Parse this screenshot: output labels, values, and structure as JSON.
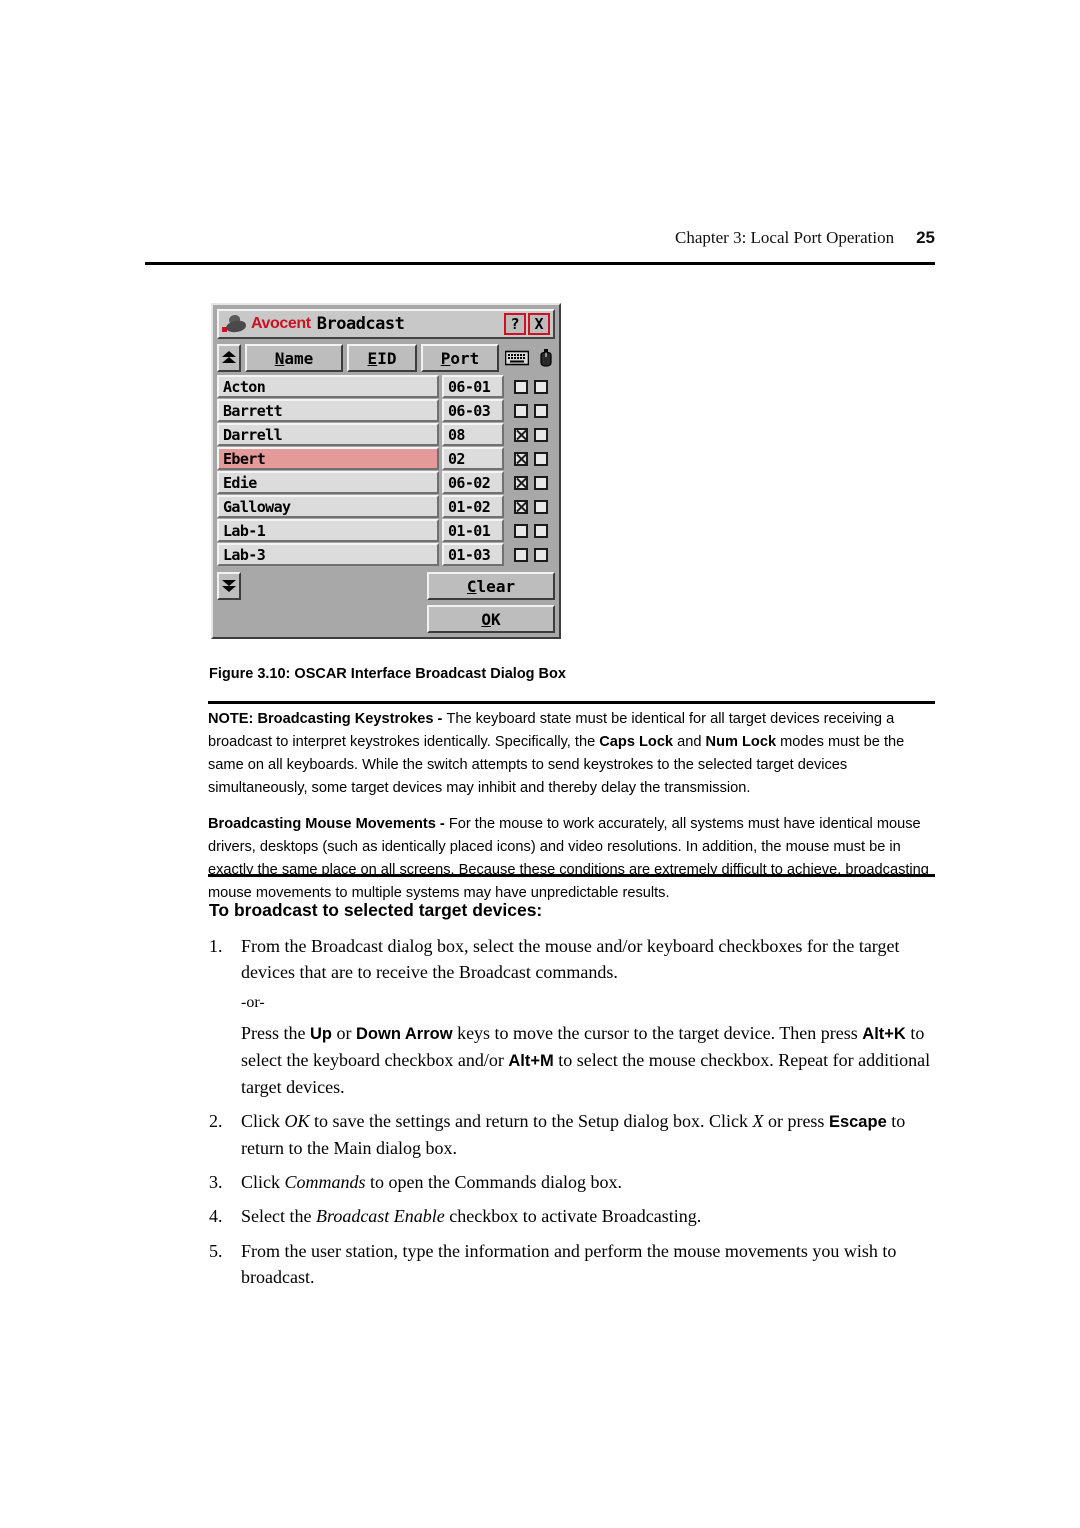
{
  "header": {
    "chapter_title": "Chapter 3: Local Port Operation",
    "page_number": "25"
  },
  "dialog": {
    "logo_word": "Avocent",
    "title": "Broadcast",
    "help_button": "?",
    "close_button": "X",
    "columns": {
      "name": "Name",
      "name_mnemonic": "N",
      "name_rest": "ame",
      "eid": "EID",
      "eid_mnemonic": "E",
      "eid_rest": "ID",
      "port": "Port",
      "port_mnemonic": "P",
      "port_rest": "ort",
      "keyboard_icon": "keyboard-icon",
      "mouse_icon": "mouse-icon"
    },
    "rows": [
      {
        "name": "Acton",
        "port": "06-01",
        "keyboard": false,
        "mouse": false,
        "selected": false
      },
      {
        "name": "Barrett",
        "port": "06-03",
        "keyboard": false,
        "mouse": false,
        "selected": false
      },
      {
        "name": "Darrell",
        "port": "08",
        "keyboard": true,
        "mouse": false,
        "selected": false
      },
      {
        "name": "Ebert",
        "port": "02",
        "keyboard": true,
        "mouse": false,
        "selected": true
      },
      {
        "name": "Edie",
        "port": "06-02",
        "keyboard": true,
        "mouse": false,
        "selected": false
      },
      {
        "name": "Galloway",
        "port": "01-02",
        "keyboard": true,
        "mouse": false,
        "selected": false
      },
      {
        "name": "Lab-1",
        "port": "01-01",
        "keyboard": false,
        "mouse": false,
        "selected": false
      },
      {
        "name": "Lab-3",
        "port": "01-03",
        "keyboard": false,
        "mouse": false,
        "selected": false
      }
    ],
    "buttons": {
      "clear_mnemonic": "C",
      "clear_rest": "lear",
      "ok_mnemonic": "O",
      "ok_rest": "K"
    },
    "scroll_up_icon": "scroll-up-icon",
    "scroll_down_icon": "scroll-down-icon",
    "selected_row_color": "#e59a9a",
    "logo_color": "#cc1122"
  },
  "figure": {
    "caption": "Figure 3.10: OSCAR Interface Broadcast Dialog Box"
  },
  "note": {
    "para1_label": "NOTE: Broadcasting Keystrokes - ",
    "para1_text_a": "The keyboard state must be identical for all target devices receiving a broadcast to interpret keystrokes identically. Specifically, the ",
    "para1_bold_a": "Caps Lock",
    "para1_text_b": " and ",
    "para1_bold_b": "Num Lock",
    "para1_text_c": " modes must be the same on all keyboards. While the switch attempts to send keystrokes to the selected target devices simultaneously, some target devices may inhibit and thereby delay the transmission.",
    "para2_label": "Broadcasting Mouse Movements - ",
    "para2_text": "For the mouse to work accurately, all systems must have identical mouse drivers, desktops (such as identically placed icons) and video resolutions. In addition, the mouse must be in exactly the same place on all screens. Because these conditions are extremely difficult to achieve, broadcasting mouse movements to multiple systems may have unpredictable results."
  },
  "procedure": {
    "heading": "To broadcast to selected target devices:",
    "steps": [
      {
        "num": "1.",
        "text": "From the Broadcast dialog box, select the mouse and/or keyboard checkboxes for the target devices that are to receive the Broadcast commands.",
        "or_label": "-or-",
        "sub_a": "Press the ",
        "sub_bold_a": "Up",
        "sub_b": " or ",
        "sub_bold_b": "Down Arrow",
        "sub_c": " keys to move the cursor to the target device. Then press ",
        "sub_bold_c": "Alt+K",
        "sub_d": " to select the keyboard checkbox and/or ",
        "sub_bold_d": "Alt+M",
        "sub_e": " to select the mouse checkbox. Repeat for additional target devices."
      },
      {
        "num": "2.",
        "text_a": "Click ",
        "italic_a": "OK",
        "text_b": " to save the settings and return to the Setup dialog box. Click ",
        "italic_b": "X",
        "text_c": " or press ",
        "bold_c": "Escape",
        "text_d": " to return to the Main dialog box."
      },
      {
        "num": "3.",
        "text_a": "Click ",
        "italic_a": "Commands",
        "text_b": " to open the Commands dialog box."
      },
      {
        "num": "4.",
        "text_a": "Select the ",
        "italic_a": "Broadcast Enable",
        "text_b": " checkbox to activate Broadcasting."
      },
      {
        "num": "5.",
        "text_a": "From the user station, type the information and perform the mouse movements you wish to broadcast."
      }
    ]
  }
}
